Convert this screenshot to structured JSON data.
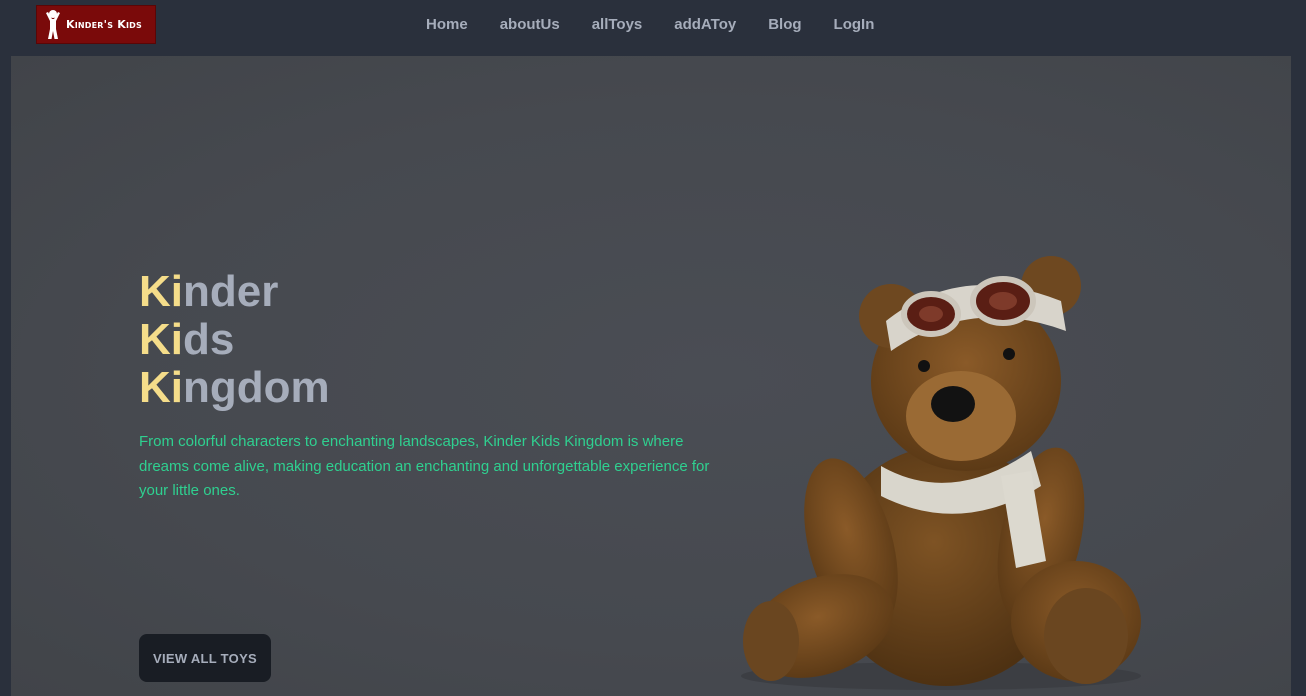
{
  "brand": {
    "logo_text": "Kinder's Kids",
    "logo_bg": "#7a0a0a"
  },
  "nav": {
    "items": [
      {
        "label": "Home"
      },
      {
        "label": "aboutUs"
      },
      {
        "label": "allToys"
      },
      {
        "label": "addAToy"
      },
      {
        "label": "Blog"
      },
      {
        "label": "LogIn"
      }
    ]
  },
  "hero": {
    "title_lines": [
      {
        "highlight": "Ki",
        "rest": "nder"
      },
      {
        "highlight": "Ki",
        "rest": "ds"
      },
      {
        "highlight": "Ki",
        "rest": "ngdom"
      }
    ],
    "description": "From colorful characters to enchanting landscapes, Kinder Kids Kingdom is where dreams come alive, making education an enchanting and unforgettable experience for your little ones.",
    "cta_label": "VIEW ALL TOYS",
    "image": "teddy-bear-with-aviator-goggles"
  },
  "colors": {
    "background": "#2a303c",
    "hero_bg": "#46494f",
    "title_highlight": "#f5dd8a",
    "title_text": "#a6adbb",
    "description_text": "#2fd090",
    "button_bg": "#191d24"
  }
}
